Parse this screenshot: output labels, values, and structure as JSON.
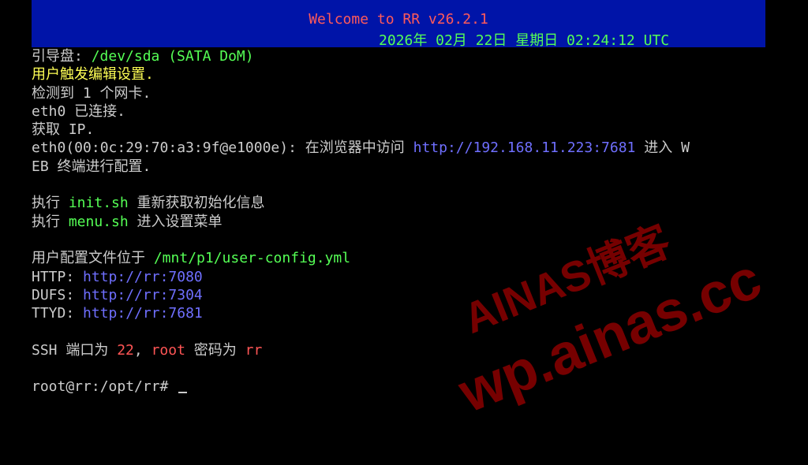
{
  "banner": {
    "title": "Welcome to RR v26.2.1",
    "datetime": "2026年 02月 22日 星期日 02:24:12 UTC"
  },
  "console": {
    "boot_disk_label": "引导盘: ",
    "boot_disk_value": "/dev/sda (SATA DoM)",
    "user_edit_msg": "用户触发编辑设置.",
    "nic_detect": "检测到 1 个网卡.",
    "eth0_connected": "eth0 已连接.",
    "get_ip": "获取 IP.",
    "eth0_access_prefix": "eth0(00:0c:29:70:a3:9f@e1000e): 在浏览器中访问 ",
    "eth0_url": "http://192.168.11.223:7681",
    "eth0_access_suffix": " 进入 W",
    "eth0_access_cont": "EB 终端进行配置.",
    "exec_label_1": "执行 ",
    "init_cmd": "init.sh",
    "init_desc": " 重新获取初始化信息",
    "exec_label_2": "执行 ",
    "menu_cmd": "menu.sh",
    "menu_desc": " 进入设置菜单",
    "config_label": "用户配置文件位于 ",
    "config_path": "/mnt/p1/user-config.yml",
    "http_label": "HTTP: ",
    "http_url": "http://rr:7080",
    "dufs_label": "DUFS: ",
    "dufs_url": "http://rr:7304",
    "ttyd_label": "TTYD: ",
    "ttyd_url": "http://rr:7681",
    "ssh_label": "SSH 端口为 ",
    "ssh_port": "22",
    "ssh_sep": ", ",
    "ssh_user": "root",
    "ssh_pw_label": " 密码为 ",
    "ssh_pw": "rr",
    "prompt": "root@rr:/opt/rr# "
  },
  "watermark": {
    "line1": "AINAS博客",
    "line2": "wp.ainas.cc"
  },
  "colors": {
    "background": "#000000",
    "banner_bg": "#0014a8",
    "text": "#cccccc",
    "green": "#55ff55",
    "yellow": "#ffff55",
    "blue_link": "#6f6fff",
    "red": "#ff5555"
  }
}
